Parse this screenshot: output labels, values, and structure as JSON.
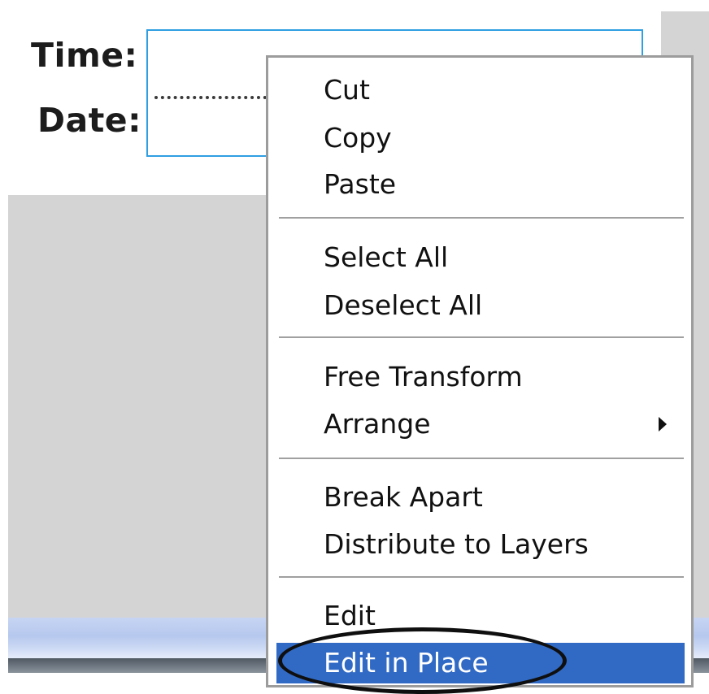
{
  "stage": {
    "time_label": "Time:",
    "date_label": "Date:"
  },
  "context_menu": {
    "items": [
      {
        "label": "Cut"
      },
      {
        "label": "Copy"
      },
      {
        "label": "Paste"
      },
      {
        "label": "Select All"
      },
      {
        "label": "Deselect All"
      },
      {
        "label": "Free Transform"
      },
      {
        "label": "Arrange",
        "has_submenu": true
      },
      {
        "label": "Break Apart"
      },
      {
        "label": "Distribute to Layers"
      },
      {
        "label": "Edit"
      },
      {
        "label": "Edit in Place",
        "highlighted": true
      }
    ]
  },
  "colors": {
    "highlight": "#316ac5",
    "selection_border": "#2f9fe2",
    "stage_gray": "#d4d4d4"
  }
}
